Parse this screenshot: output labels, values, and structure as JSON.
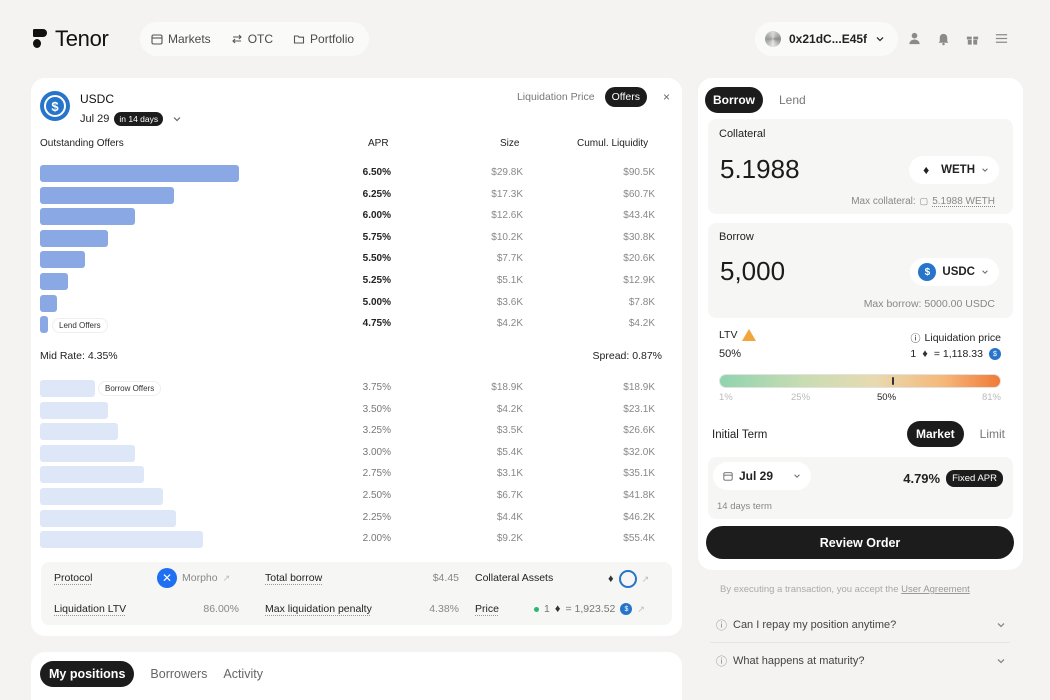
{
  "brand": {
    "name": "Tenor"
  },
  "nav": [
    {
      "label": "Markets",
      "icon": "calendar-icon"
    },
    {
      "label": "OTC",
      "icon": "swap-icon"
    },
    {
      "label": "Portfolio",
      "icon": "folder-icon"
    }
  ],
  "wallet": {
    "address": "0x21dC...E45f"
  },
  "header_icons": [
    "user-icon",
    "bell-icon",
    "gift-icon",
    "menu-icon"
  ],
  "market": {
    "asset": "USDC",
    "maturity": "Jul 29",
    "maturity_badge": "in 14 days",
    "toggle_liquidation": "Liquidation Price",
    "toggle_offers": "Offers",
    "close": "×"
  },
  "table_headers": {
    "outstanding": "Outstanding Offers",
    "apr": "APR",
    "size": "Size",
    "cumulative": "Cumul. Liquidity"
  },
  "lend_offers": [
    {
      "apr": "6.50%",
      "size": "$29.8K",
      "cum": "$90.5K",
      "fill": 0.94
    },
    {
      "apr": "6.25%",
      "size": "$17.3K",
      "cum": "$60.7K",
      "fill": 0.63
    },
    {
      "apr": "6.00%",
      "size": "$12.6K",
      "cum": "$43.4K",
      "fill": 0.45
    },
    {
      "apr": "5.75%",
      "size": "$10.2K",
      "cum": "$30.8K",
      "fill": 0.32
    },
    {
      "apr": "5.50%",
      "size": "$7.7K",
      "cum": "$20.6K",
      "fill": 0.21
    },
    {
      "apr": "5.25%",
      "size": "$5.1K",
      "cum": "$12.9K",
      "fill": 0.13
    },
    {
      "apr": "5.00%",
      "size": "$3.6K",
      "cum": "$7.8K",
      "fill": 0.08
    },
    {
      "apr": "4.75%",
      "size": "$4.2K",
      "cum": "$4.2K",
      "fill": 0.04
    }
  ],
  "lend_tag": "Lend Offers",
  "mid_rate": "Mid Rate: 4.35%",
  "spread": "Spread: 0.87%",
  "borrow_tag": "Borrow Offers",
  "borrow_offers": [
    {
      "apr": "3.75%",
      "size": "$18.9K",
      "cum": "$18.9K",
      "fill": 0.26
    },
    {
      "apr": "3.50%",
      "size": "$4.2K",
      "cum": "$23.1K",
      "fill": 0.32
    },
    {
      "apr": "3.25%",
      "size": "$3.5K",
      "cum": "$26.6K",
      "fill": 0.37
    },
    {
      "apr": "3.00%",
      "size": "$5.4K",
      "cum": "$32.0K",
      "fill": 0.45
    },
    {
      "apr": "2.75%",
      "size": "$3.1K",
      "cum": "$35.1K",
      "fill": 0.49
    },
    {
      "apr": "2.50%",
      "size": "$6.7K",
      "cum": "$41.8K",
      "fill": 0.58
    },
    {
      "apr": "2.25%",
      "size": "$4.4K",
      "cum": "$46.2K",
      "fill": 0.64
    },
    {
      "apr": "2.00%",
      "size": "$9.2K",
      "cum": "$55.4K",
      "fill": 0.77
    }
  ],
  "info": {
    "protocol_label": "Protocol",
    "protocol_value": "Morpho",
    "total_borrow_label": "Total borrow",
    "total_borrow_value": "$4.45",
    "collateral_label": "Collateral Assets",
    "liq_ltv_label": "Liquidation LTV",
    "liq_ltv_value": "86.00%",
    "max_penalty_label": "Max liquidation penalty",
    "max_penalty_value": "4.38%",
    "price_label": "Price",
    "price_lhs": "1",
    "price_rhs": "= 1,923.52"
  },
  "bottom_tabs": [
    "My positions",
    "Borrowers",
    "Activity"
  ],
  "order": {
    "tab_borrow": "Borrow",
    "tab_lend": "Lend",
    "collateral_label": "Collateral",
    "collateral_amount": "5.1988",
    "collateral_token": "WETH",
    "max_collateral_label": "Max collateral:",
    "max_collateral_value": "5.1988 WETH",
    "borrow_label": "Borrow",
    "borrow_amount": "5,000",
    "borrow_token": "USDC",
    "max_borrow": "Max borrow: 5000.00 USDC",
    "ltv_label": "LTV",
    "ltv_value": "50%",
    "ltv_fraction": 0.5,
    "liq_price_label": "Liquidation price",
    "liq_price_lhs": "1",
    "liq_price_rhs": "= 1,118.33",
    "gauge_ticks": [
      "1%",
      "25%",
      "50%",
      "81%"
    ],
    "initial_term_label": "Initial Term",
    "term_market": "Market",
    "term_limit": "Limit",
    "term_date": "Jul 29",
    "term_sub": "14 days term",
    "apr": "4.79%",
    "apr_badge": "Fixed APR",
    "review_button": "Review Order"
  },
  "disclaimer": {
    "text": "By executing a transaction, you accept the",
    "link": "User Agreement"
  },
  "faq": [
    "Can I repay my position anytime?",
    "What happens at maturity?"
  ],
  "colors": {
    "lend_bar": "#8aa9e4",
    "borrow_bar": "#dde7f8",
    "usdc_blue": "#2775ca",
    "dark": "#1c1c1c",
    "warning": "#f2a53a"
  }
}
